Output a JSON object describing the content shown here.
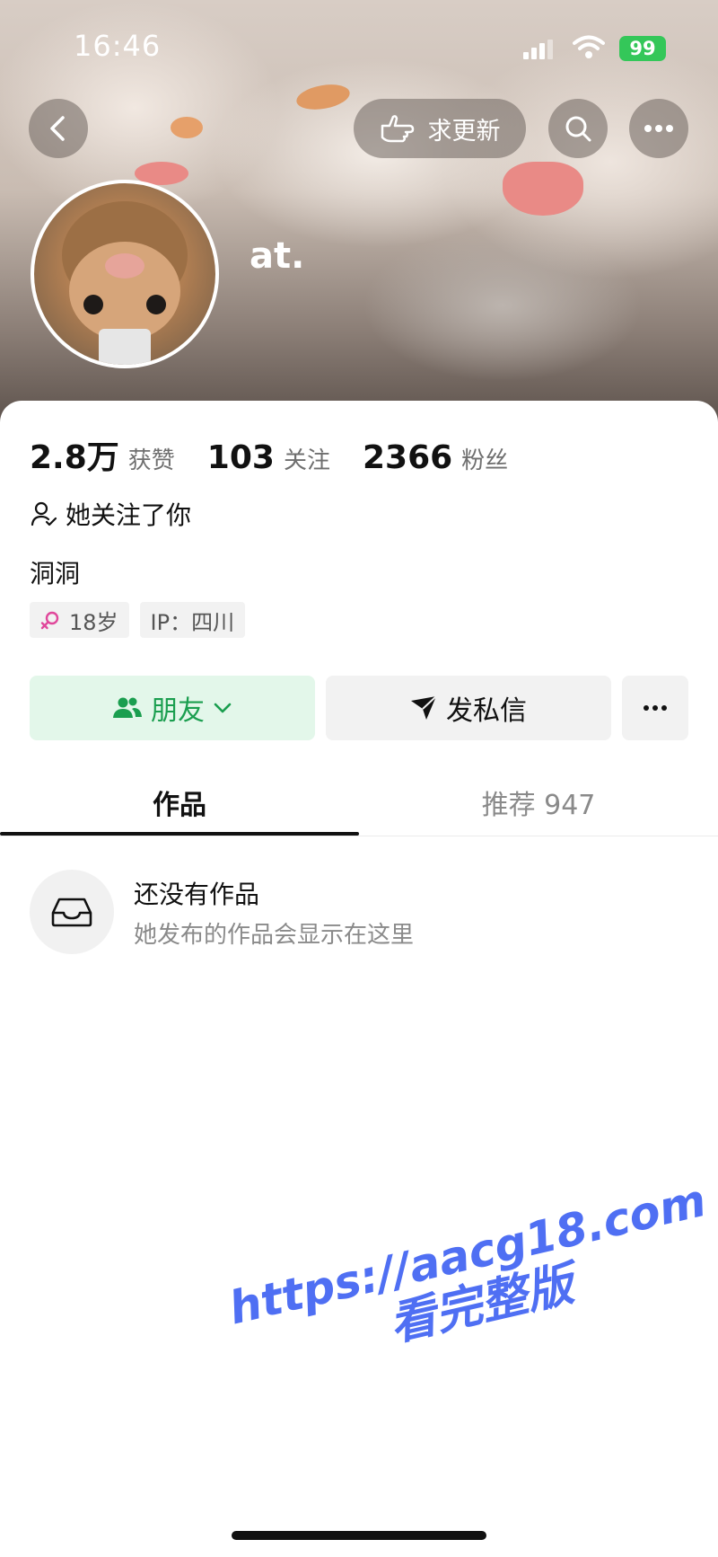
{
  "status_bar": {
    "time": "16:46",
    "battery": "99"
  },
  "header": {
    "request_update_label": "求更新",
    "username": "at."
  },
  "stats": [
    {
      "value": "2.8万",
      "label": "获赞"
    },
    {
      "value": "103",
      "label": "关注"
    },
    {
      "value": "2366",
      "label": "粉丝"
    }
  ],
  "follow_note": "她关注了你",
  "bio": "洞洞",
  "tags": {
    "age": "18岁",
    "ip": "IP：四川"
  },
  "actions": {
    "friend_label": "朋友",
    "message_label": "发私信"
  },
  "tabs": [
    {
      "label": "作品"
    },
    {
      "label": "推荐 947"
    }
  ],
  "empty_state": {
    "title": "还没有作品",
    "subtitle": "她发布的作品会显示在这里"
  },
  "watermark": {
    "url": "https://aacg18.com",
    "text": "看完整版"
  },
  "colors": {
    "accent_green": "#1a9e4f",
    "friend_bg": "#e3f7ea",
    "watermark_blue": "#4f6ff3",
    "battery_green": "#34c759"
  }
}
